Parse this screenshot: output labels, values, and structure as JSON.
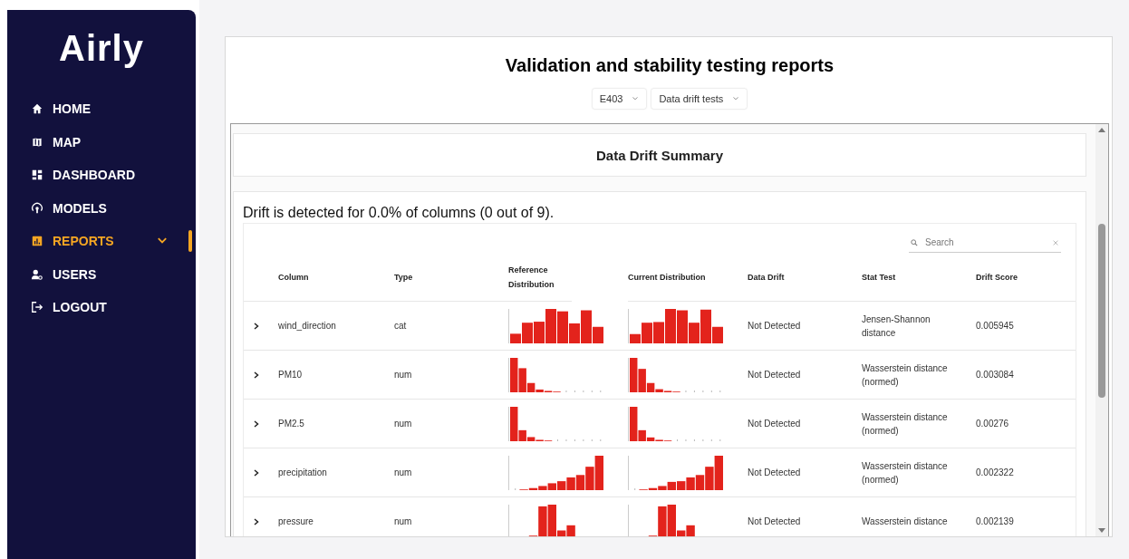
{
  "sidebar": {
    "logo": "Airly",
    "items": [
      {
        "label": "HOME",
        "selected": false,
        "expandable": false
      },
      {
        "label": "MAP",
        "selected": false,
        "expandable": false
      },
      {
        "label": "DASHBOARD",
        "selected": false,
        "expandable": false
      },
      {
        "label": "MODELS",
        "selected": false,
        "expandable": false
      },
      {
        "label": "REPORTS",
        "selected": true,
        "expandable": true
      },
      {
        "label": "USERS",
        "selected": false,
        "expandable": false
      },
      {
        "label": "LOGOUT",
        "selected": false,
        "expandable": false
      }
    ]
  },
  "page": {
    "title": "Validation and stability testing reports",
    "dropdowns": [
      {
        "value": "E403"
      },
      {
        "value": "Data drift tests"
      }
    ]
  },
  "report": {
    "summary_title": "Data Drift Summary",
    "drift_text": "Drift is detected for 0.0% of columns (0 out of 9).",
    "search": {
      "placeholder": "Search"
    },
    "columns": [
      "Column",
      "Type",
      "Reference Distribution",
      "Current Distribution",
      "Data Drift",
      "Stat Test",
      "Drift Score"
    ],
    "rows": [
      {
        "column": "wind_direction",
        "type": "cat",
        "data_drift": "Not Detected",
        "stat_test": "Jensen-Shannon distance",
        "drift_score": "0.005945"
      },
      {
        "column": "PM10",
        "type": "num",
        "data_drift": "Not Detected",
        "stat_test": "Wasserstein distance (normed)",
        "drift_score": "0.003084"
      },
      {
        "column": "PM2.5",
        "type": "num",
        "data_drift": "Not Detected",
        "stat_test": "Wasserstein distance (normed)",
        "drift_score": "0.00276"
      },
      {
        "column": "precipitation",
        "type": "num",
        "data_drift": "Not Detected",
        "stat_test": "Wasserstein distance (normed)",
        "drift_score": "0.002322"
      },
      {
        "column": "pressure",
        "type": "num",
        "data_drift": "Not Detected",
        "stat_test": "Wasserstein distance",
        "drift_score": "0.002139"
      }
    ]
  }
}
